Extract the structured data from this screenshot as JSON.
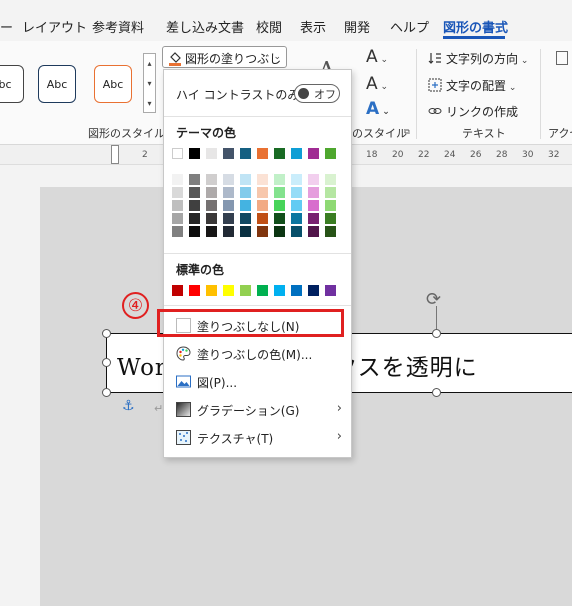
{
  "tabs": [
    "ー",
    "レイアウト",
    "参考資料",
    "差し込み文書",
    "校閲",
    "表示",
    "開発",
    "ヘルプ",
    "図形の書式"
  ],
  "ribbon": {
    "style_samples": [
      "bc",
      "Abc",
      "Abc"
    ],
    "fill_button_label": "図形の塗りつぶし",
    "shape_style_group": "図形のスタイル",
    "wordart_group_partial": "のスタイル",
    "text_group": "テキスト",
    "accessibility_partial": "アクセ",
    "text_direction": "文字列の方向",
    "align_text": "文字の配置",
    "create_link": "リンクの作成",
    "font_a": "A"
  },
  "ruler_ticks": [
    "2",
    "16",
    "18",
    "20",
    "22",
    "24",
    "26",
    "28",
    "30",
    "32"
  ],
  "document": {
    "textbox_text": "Word テキストボックスを透明に",
    "step_badge": "④"
  },
  "dropdown": {
    "high_contrast_label": "ハイ コントラストのみ(H)",
    "toggle_label": "オフ",
    "theme_colors_title": "テーマの色",
    "standard_colors_title": "標準の色",
    "theme_top_row": [
      "#ffffff",
      "#000000",
      "#e7e6e6",
      "#44546a",
      "#156082",
      "#e97132",
      "#196b24",
      "#0f9ed5",
      "#a02b93",
      "#4ea72e"
    ],
    "theme_shades": [
      [
        "#f2f2f2",
        "#d9d9d9",
        "#bfbfbf",
        "#a6a6a6",
        "#808080"
      ],
      [
        "#7f7f7f",
        "#595959",
        "#404040",
        "#262626",
        "#0d0d0d"
      ],
      [
        "#d0cece",
        "#aeaaaa",
        "#757171",
        "#3a3838",
        "#171616"
      ],
      [
        "#d6dce4",
        "#adb9ca",
        "#8497b0",
        "#333f4f",
        "#222a35"
      ],
      [
        "#c0e4f5",
        "#83cbeb",
        "#44b3e1",
        "#104862",
        "#0a3041"
      ],
      [
        "#fbe2d5",
        "#f7c7ac",
        "#f2aa84",
        "#c04f15",
        "#80350e"
      ],
      [
        "#c1f0c8",
        "#83e28e",
        "#47d459",
        "#124f1b",
        "#0c3512"
      ],
      [
        "#caedfb",
        "#95dcf7",
        "#61cbf3",
        "#0b76a0",
        "#074f6a"
      ],
      [
        "#f2cfee",
        "#e59edd",
        "#d86dcd",
        "#782070",
        "#51154a"
      ],
      [
        "#d9f2d0",
        "#b5e6a2",
        "#8ed973",
        "#3a7d22",
        "#275317"
      ]
    ],
    "standard_colors": [
      "#c00000",
      "#ff0000",
      "#ffc000",
      "#ffff00",
      "#92d050",
      "#00b050",
      "#00b0f0",
      "#0070c0",
      "#002060",
      "#7030a0"
    ],
    "no_fill_label": "塗りつぶしなし(N)",
    "more_colors_label": "塗りつぶしの色(M)...",
    "picture_label": "図(P)...",
    "gradient_label": "グラデーション(G)",
    "texture_label": "テクスチャ(T)"
  },
  "colors": {
    "accent": "#1a56b8",
    "highlight": "#e02020"
  }
}
